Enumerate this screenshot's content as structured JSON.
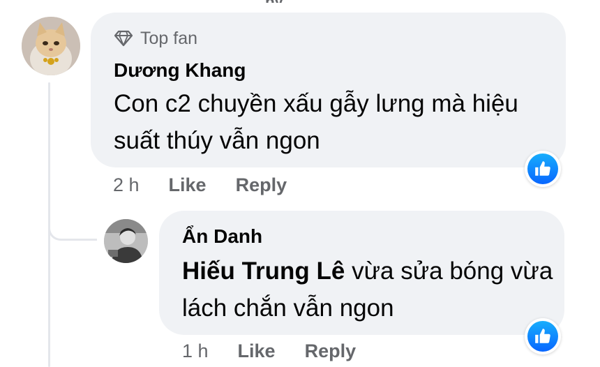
{
  "comment": {
    "badge_label": "Top fan",
    "badge_icon": "diamond-icon",
    "author": "Dương Khang",
    "text": "Con c2 chuyền xấu gẫy lưng mà hiệu suất thúy vẫn ngon",
    "time": "2 h",
    "like_label": "Like",
    "reply_label": "Reply",
    "reaction_icon": "thumbs-up-icon"
  },
  "reply": {
    "author": "Ẩn Danh",
    "mention": "Hiếu Trung Lê",
    "text": " vừa sửa bóng vừa lách chắn vẫn ngon",
    "time": "1 h",
    "like_label": "Like",
    "reply_label": "Reply",
    "reaction_icon": "thumbs-up-icon"
  },
  "colors": {
    "bubble": "#f0f2f5",
    "secondary_text": "#65676b",
    "like_blue": "#0866ff"
  }
}
